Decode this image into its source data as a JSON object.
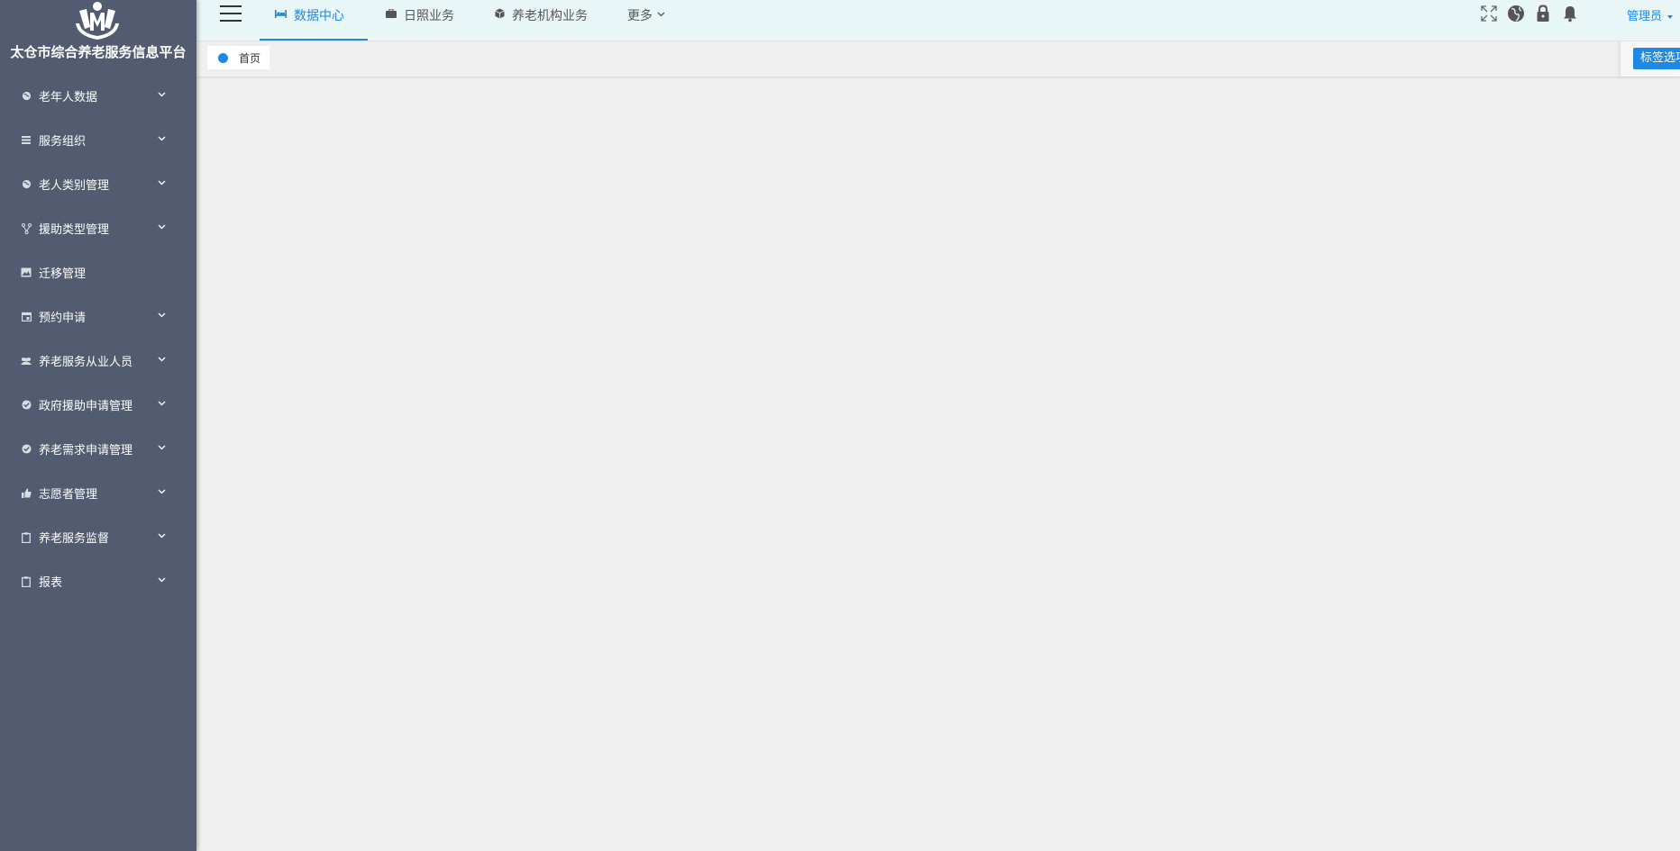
{
  "app": {
    "brand": "太仓市综合养老服务信息平台"
  },
  "sidebar": {
    "items": [
      {
        "label": "老年人数据",
        "icon": "globe-icon"
      },
      {
        "label": "服务组织",
        "icon": "list-icon"
      },
      {
        "label": "老人类别管理",
        "icon": "globe-icon"
      },
      {
        "label": "援助类型管理",
        "icon": "fork-icon"
      },
      {
        "label": "迁移管理",
        "icon": "image-icon"
      },
      {
        "label": "预约申请",
        "icon": "calendar-icon"
      },
      {
        "label": "养老服务从业人员",
        "icon": "group-icon"
      },
      {
        "label": "政府援助申请管理",
        "icon": "check-circle-icon"
      },
      {
        "label": "养老需求申请管理",
        "icon": "check-circle-icon"
      },
      {
        "label": "志愿者管理",
        "icon": "thumbs-up-icon"
      },
      {
        "label": "养老服务监督",
        "icon": "clipboard-icon"
      },
      {
        "label": "报表",
        "icon": "clipboard-icon"
      }
    ]
  },
  "topbar": {
    "tabs": [
      {
        "label": "数据中心",
        "icon": "bed-icon",
        "active": true
      },
      {
        "label": "日照业务",
        "icon": "briefcase-icon",
        "active": false
      },
      {
        "label": "养老机构业务",
        "icon": "cube-icon",
        "active": false
      }
    ],
    "more_label": "更多",
    "user_label": "管理员",
    "tools": [
      "fullscreen-icon",
      "globe-icon",
      "lock-icon",
      "bell-icon"
    ]
  },
  "pagetabs": {
    "home_label": "首页",
    "tag_select_label": "标签选项"
  },
  "colors": {
    "sidebar_bg": "#525b6f",
    "accent": "#1e88e5",
    "topbar_bg": "#e9f6f8",
    "content_bg": "#f0f0f0"
  }
}
